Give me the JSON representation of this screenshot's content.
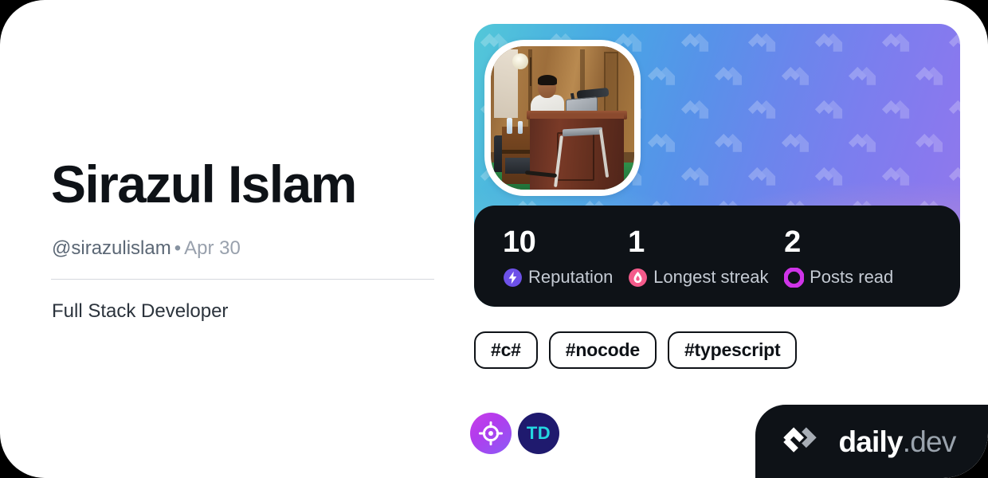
{
  "card": {
    "background_color": "#ffffff",
    "page_background": "#000000"
  },
  "profile": {
    "display_name": "Sirazul Islam",
    "handle": "@sirazulislam",
    "separator": "•",
    "join_date": "Apr 30",
    "bio": "Full Stack Developer",
    "avatar_alt": "person presenting at a wooden podium with a laptop"
  },
  "stats": [
    {
      "value": "10",
      "label": "Reputation",
      "icon": "lightning-bolt-icon",
      "icon_color": "#6d51e8"
    },
    {
      "value": "1",
      "label": "Longest streak",
      "icon": "flame-icon",
      "icon_color": "#f45b8b"
    },
    {
      "value": "2",
      "label": "Posts read",
      "icon": "ring-icon",
      "icon_color": "#cf34e8"
    }
  ],
  "tags": [
    {
      "label": "#c#"
    },
    {
      "label": "#nocode"
    },
    {
      "label": "#typescript"
    }
  ],
  "badges": [
    {
      "name": "crosshair-badge",
      "text": "",
      "icon": "crosshair-icon"
    },
    {
      "name": "td-badge",
      "text": "TD",
      "icon": "td-monogram-icon"
    }
  ],
  "branding": {
    "logo_icon": "daily-dev-logo-icon",
    "wordmark_primary": "daily",
    "wordmark_secondary": ".dev"
  },
  "cover": {
    "gradient_start": "#53c8d8",
    "gradient_mid": "#5792e9",
    "gradient_end": "#9479ea",
    "watermark_icon": "daily-dev-pattern-icon"
  }
}
